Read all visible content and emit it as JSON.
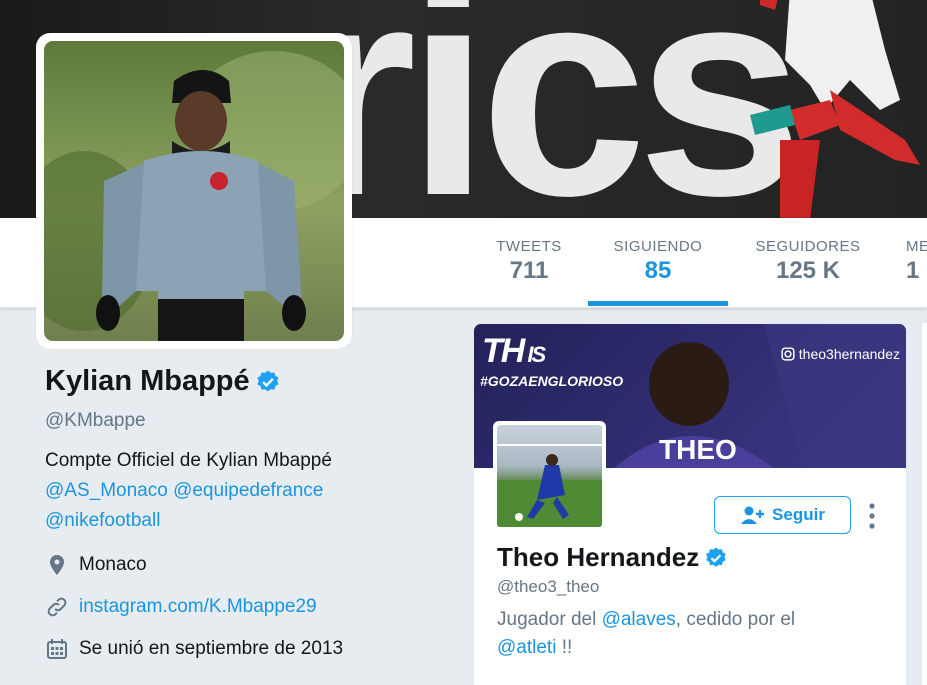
{
  "banner": {
    "text": "rics"
  },
  "nav": {
    "items": [
      {
        "label": "TWEETS",
        "value": "711"
      },
      {
        "label": "SIGUIENDO",
        "value": "85"
      },
      {
        "label": "SEGUIDORES",
        "value": "125 K"
      },
      {
        "label": "ME",
        "value": "1"
      }
    ],
    "active_index": 1
  },
  "profile": {
    "name": "Kylian Mbappé",
    "handle": "@KMbappe",
    "bio_text": "Compte Officiel de Kylian Mbappé",
    "bio_mention_1": "@AS_Monaco",
    "bio_mention_2": "@equipedefrance",
    "bio_mention_3": "@nikefootball",
    "location": "Monaco",
    "website": "instagram.com/K.Mbappe29",
    "joined": "Se unió en septiembre de 2013"
  },
  "card": {
    "banner_th": "TH",
    "banner_is": "IS",
    "banner_hashtag": "#GOZAENGLORIOSO",
    "banner_ig": "theo3hernandez",
    "banner_shirt": "THEO",
    "name": "Theo Hernandez",
    "handle": "@theo3_theo",
    "follow_label": "Seguir",
    "bio_prefix": "Jugador del ",
    "bio_mention_1": "@alaves",
    "bio_middle": ", cedido por el",
    "bio_mention_2": "@atleti",
    "bio_suffix": " !!"
  },
  "colors": {
    "accent": "#1b95e0",
    "verified": "#1da1f2",
    "muted": "#657786",
    "page_bg": "#e6ecf0"
  }
}
